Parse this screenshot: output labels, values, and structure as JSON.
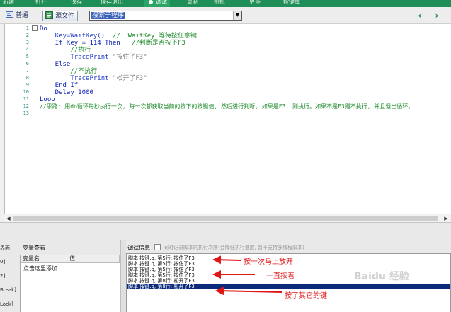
{
  "toolbar": {
    "buttons": [
      "新建",
      "打开",
      "保存",
      "保存退出",
      "调试",
      "录制",
      "抓抓",
      "更多",
      "按键库"
    ],
    "active_index": 4
  },
  "tabs": {
    "normal": "普通",
    "source": "源文件"
  },
  "subroutine_select": {
    "value": "搜索子程序"
  },
  "editor": {
    "line_numbers": [
      "1",
      "2",
      "3",
      "4",
      "5",
      "6",
      "7",
      "8",
      "9",
      "10",
      "11",
      "12",
      "13"
    ],
    "lines": {
      "l1": "Do",
      "l2a": "    Key=WaitKey()",
      "l2b": "  //  WaitKey 等待按任意键",
      "l3a": "    If Key = 114 Then",
      "l3b": "   //判断是否按下F3",
      "l4": "        //执行",
      "l5a": "        TracePrint",
      "l5b": " \"按住了F3\"",
      "l6": "    Else",
      "l7": "        //不执行",
      "l8a": "        TracePrint",
      "l8b": " \"松开了F3\"",
      "l9": "    End If",
      "l10": "    Delay 1000",
      "l11": "Loop",
      "l12": "//思路: 用do循环每秒执行一次, 每一次都获取当前的按下的按键值, 然后进行判断, 如果是F3, 则执行。如果不是F3则不执行, 并且退出循环。"
    }
  },
  "left_panel": {
    "items": [
      "界面",
      "0]",
      "2]",
      "Break]",
      "Lock]"
    ]
  },
  "variables": {
    "title": "变量查看",
    "col_name": "变量名",
    "col_value": "值",
    "add_hint": "点击这里添加"
  },
  "debug": {
    "title": "调试信息",
    "option_label": "同时记录脚本的执行次序(会降低执行速度, 暂不支持多线程脚本)",
    "log": [
      "脚本 按键.q, 第5行: 按住了F3",
      "脚本 按键.q, 第5行: 按住了F3",
      "脚本 按键.q, 第5行: 按住了F3",
      "脚本 按键.q, 第5行: 按住了F3",
      "脚本 按键.q, 第8行: 松开了F3",
      "脚本 按键.q, 第8行: 松开了F3"
    ],
    "selected_index": 5
  },
  "annotations": {
    "a1": "按一次马上放开",
    "a2": "一直按着",
    "a3": "按了其它的键"
  },
  "watermark": "Baidu 经验",
  "colors": {
    "toolbar_green": "#1f8f57",
    "keyword_blue": "#0a1cb5",
    "comment_green": "#1e8a2a",
    "annotation_red": "#e01616",
    "selection_navy": "#0b2a7a"
  },
  "icons": {
    "nav_prev": "chevron-left-icon",
    "nav_next": "chevron-right-icon"
  }
}
